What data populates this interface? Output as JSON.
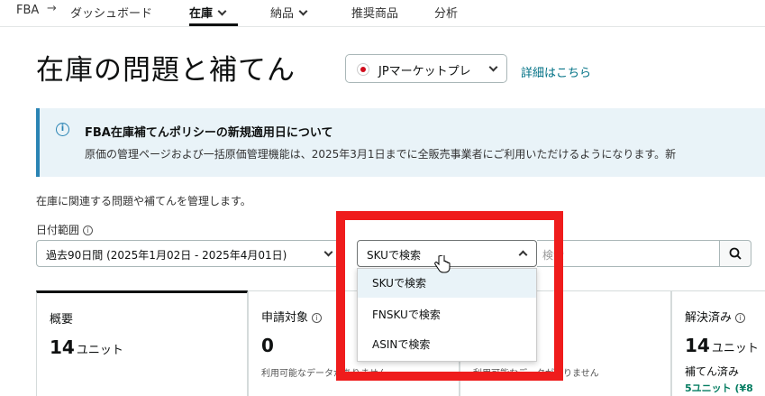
{
  "nav": {
    "fba": "FBA",
    "arrow": "→",
    "dashboard": "ダッシュボード",
    "inventory": "在庫",
    "delivery": "納品",
    "recommended": "推奨商品",
    "analytics": "分析"
  },
  "page": {
    "title": "在庫の問題と補てん",
    "marketplace": "JPマーケットプレ",
    "details_link": "詳細はこちら"
  },
  "banner": {
    "title": "FBA在庫補てんポリシーの新規適用日について",
    "text": "原価の管理ページおよび一括原価管理機能は、2025年3月1日までに全販売事業者にご利用いただけるようになります。新"
  },
  "description": "在庫に関連する問題や補てんを管理します。",
  "date_range": {
    "label": "日付範囲",
    "value": "過去90日間 (2025年1月02日 - 2025年4月01日)"
  },
  "search": {
    "type_selected": "SKUで検索",
    "placeholder": "検索",
    "options": [
      "SKUで検索",
      "FNSKUで検索",
      "ASINで検索"
    ]
  },
  "cards": [
    {
      "title": "概要",
      "value": "14",
      "unit": "ユニット"
    },
    {
      "title": "申請対象",
      "value": "0",
      "note": "利用可能なデータがありません"
    },
    {
      "title": "",
      "value": "",
      "note": "利用可能なデータがありません"
    },
    {
      "title": "解決済み",
      "value": "14",
      "unit": "ユニット",
      "sub": "補てん済み",
      "green": "5ユニット (¥8"
    }
  ],
  "colors": {
    "accent": "#007185",
    "banner_bg": "#e9f3f8",
    "highlight": "#ef1c1c",
    "green": "#067d62"
  }
}
